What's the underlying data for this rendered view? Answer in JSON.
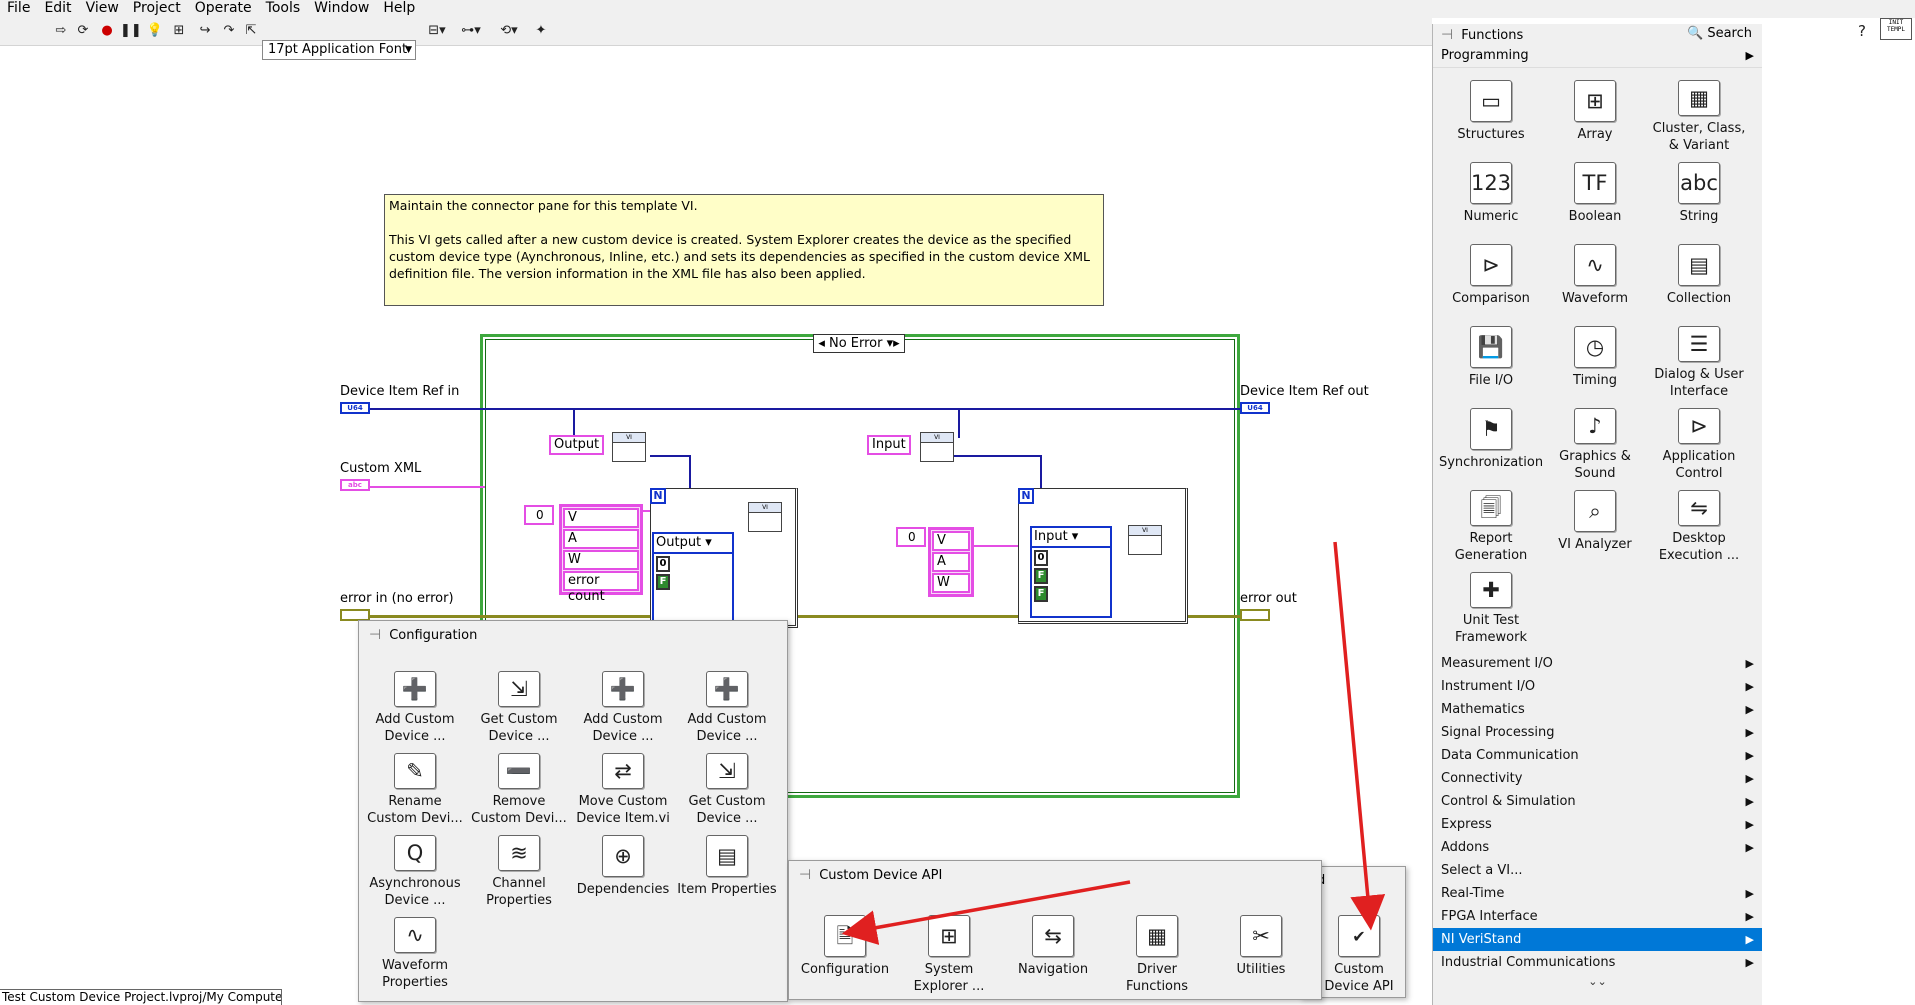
{
  "menu": [
    "File",
    "Edit",
    "View",
    "Project",
    "Operate",
    "Tools",
    "Window",
    "Help"
  ],
  "toolbar": {
    "font_selector": "17pt Application Font"
  },
  "template_icon_label": "INIT\nTEMPL",
  "comment": {
    "line1": "Maintain the connector pane for this template VI.",
    "line2": "This VI gets called after a new custom device is created. System Explorer creates the device as the specified custom device type (Aynchronous, Inline, etc.) and sets its dependencies as specified in the custom device XML definition file. The version information in the XML file has also been applied."
  },
  "diagram": {
    "case_selector": "No Error",
    "labels": {
      "device_item_ref_in": "Device Item Ref in",
      "custom_xml": "Custom XML",
      "error_in": "error in (no error)",
      "device_item_ref_out": "Device Item Ref out",
      "error_out": "error out"
    },
    "terminals": {
      "u64": "U64",
      "abc": "abc"
    },
    "tags": {
      "output": "Output",
      "input": "Input"
    },
    "output_cluster": [
      "V",
      "A",
      "W",
      "error count"
    ],
    "input_cluster": [
      "V",
      "A",
      "W"
    ],
    "zero": "0",
    "loop_n": "N",
    "output_unbundle": "Output",
    "input_unbundle": "Input",
    "pins": {
      "zero": "0",
      "f": "F"
    }
  },
  "config_palette": {
    "title": "Configuration",
    "items": [
      {
        "label": "Add Custom Device ...",
        "icon": "add-custom-device-icon"
      },
      {
        "label": "Get Custom Device ...",
        "icon": "get-custom-device-icon"
      },
      {
        "label": "Add Custom Device ...",
        "icon": "add-custom-device-item-icon"
      },
      {
        "label": "Add Custom Device ...",
        "icon": "add-custom-device-section-icon"
      },
      {
        "label": "Rename Custom Devi...",
        "icon": "rename-icon"
      },
      {
        "label": "Remove Custom Devi...",
        "icon": "remove-icon"
      },
      {
        "label": "Move Custom Device Item.vi",
        "icon": "move-icon"
      },
      {
        "label": "Get Custom Device ...",
        "icon": "get-device-properties-icon"
      },
      {
        "label": "Asynchronous Device ...",
        "icon": "asynchronous-icon"
      },
      {
        "label": "Channel Properties",
        "icon": "channel-properties-icon"
      },
      {
        "label": "Dependencies",
        "icon": "dependencies-icon"
      },
      {
        "label": "Item Properties",
        "icon": "item-properties-icon"
      },
      {
        "label": "Waveform Properties",
        "icon": "waveform-properties-icon"
      }
    ]
  },
  "cdapi_palette": {
    "title": "Custom Device API",
    "behind_fragment": "d",
    "items": [
      {
        "label": "Configuration",
        "icon": "configuration-folder-icon"
      },
      {
        "label": "System Explorer ...",
        "icon": "system-explorer-folder-icon"
      },
      {
        "label": "Navigation",
        "icon": "navigation-folder-icon"
      },
      {
        "label": "Driver Functions",
        "icon": "driver-functions-folder-icon"
      },
      {
        "label": "Utilities",
        "icon": "utilities-folder-icon"
      }
    ],
    "outer_item": {
      "label": "Custom Device API",
      "icon": "custom-device-api-icon"
    }
  },
  "functions_palette": {
    "title": "Functions",
    "search": "Search",
    "programming": "Programming",
    "items": [
      {
        "label": "Structures",
        "icon": "structures-icon"
      },
      {
        "label": "Array",
        "icon": "array-icon"
      },
      {
        "label": "Cluster, Class, & Variant",
        "icon": "cluster-icon"
      },
      {
        "label": "Numeric",
        "icon": "numeric-icon"
      },
      {
        "label": "Boolean",
        "icon": "boolean-icon"
      },
      {
        "label": "String",
        "icon": "string-icon"
      },
      {
        "label": "Comparison",
        "icon": "comparison-icon"
      },
      {
        "label": "Waveform",
        "icon": "waveform-icon"
      },
      {
        "label": "Collection",
        "icon": "collection-icon"
      },
      {
        "label": "File I/O",
        "icon": "file-io-icon"
      },
      {
        "label": "Timing",
        "icon": "timing-icon"
      },
      {
        "label": "Dialog & User Interface",
        "icon": "dialog-icon"
      },
      {
        "label": "Synchronization",
        "icon": "synchronization-icon"
      },
      {
        "label": "Graphics & Sound",
        "icon": "graphics-icon"
      },
      {
        "label": "Application Control",
        "icon": "application-control-icon"
      },
      {
        "label": "Report Generation",
        "icon": "report-icon"
      },
      {
        "label": "VI Analyzer",
        "icon": "vi-analyzer-icon"
      },
      {
        "label": "Desktop Execution ...",
        "icon": "desktop-execution-icon"
      },
      {
        "label": "Unit Test Framework",
        "icon": "unit-test-icon"
      }
    ],
    "categories": [
      "Measurement I/O",
      "Instrument I/O",
      "Mathematics",
      "Signal Processing",
      "Data Communication",
      "Connectivity",
      "Control & Simulation",
      "Express",
      "Addons",
      "Select a VI...",
      "Real-Time",
      "FPGA Interface",
      "NI VeriStand",
      "Industrial Communications"
    ],
    "selected": "NI VeriStand",
    "no_arrow": [
      "Select a VI..."
    ]
  },
  "status_bar": "Test Custom Device Project.lvproj/My Computer",
  "colors": {
    "accent": "#0078d7",
    "arrow": "#e02020",
    "case_border": "#3ea83e",
    "wire_pink": "#e44ee4",
    "wire_blue": "#1a1aa0"
  }
}
